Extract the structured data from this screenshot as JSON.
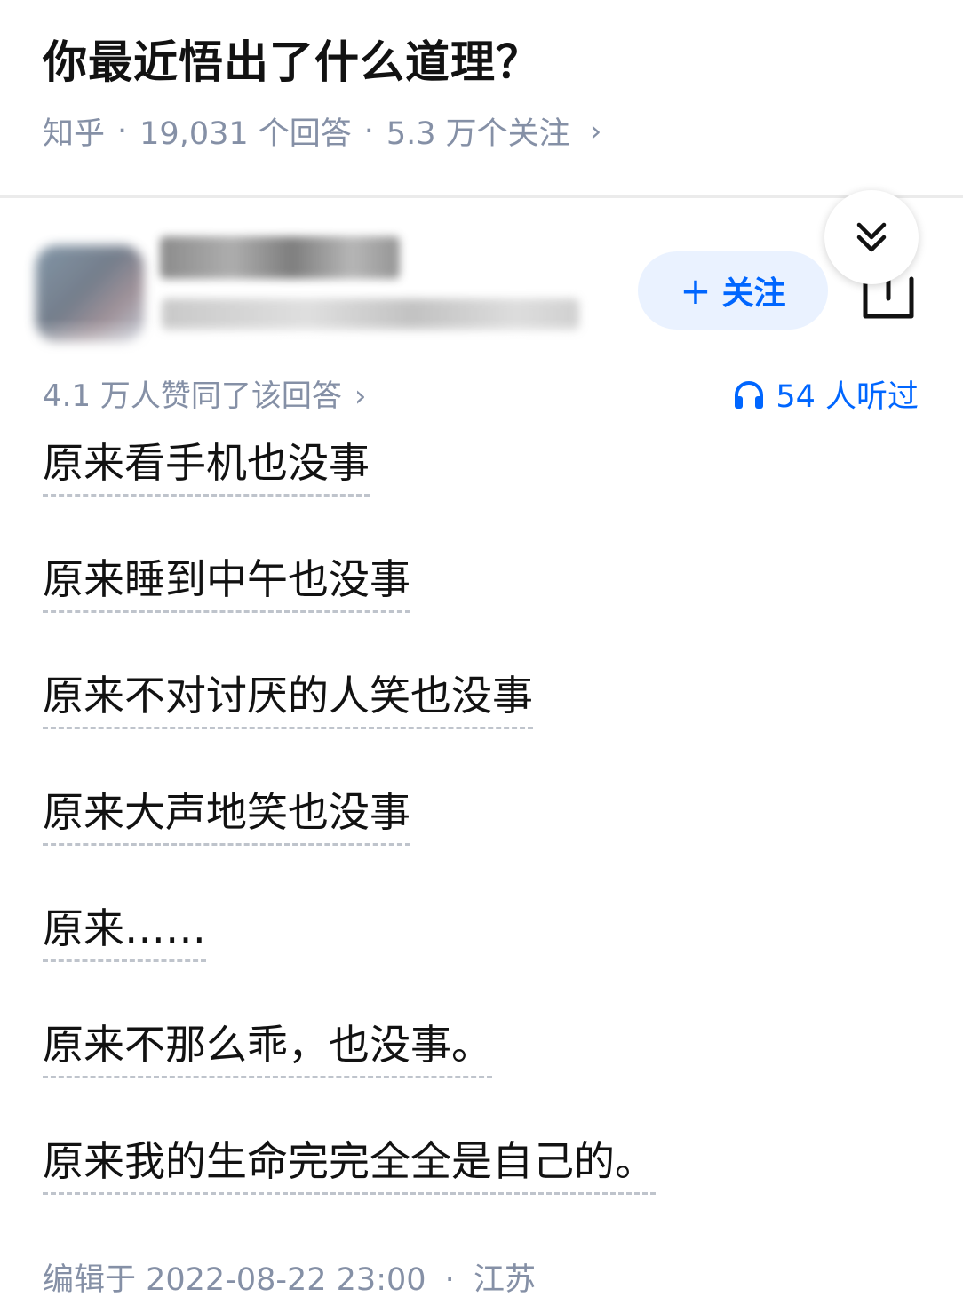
{
  "question": {
    "title": "你最近悟出了什么道理？",
    "source": "知乎",
    "answers": "19,031 个回答",
    "followers": "5.3 万个关注",
    "separator": "·",
    "chevron": "›"
  },
  "author": {
    "follow_label": "关注",
    "follow_plus": "+"
  },
  "answer": {
    "votes_text": "4.1 万人赞同了该回答",
    "votes_chevron": "›",
    "listened_text": "54 人听过",
    "lines": [
      "原来看手机也没事",
      "原来睡到中午也没事",
      "原来不对讨厌的人笑也没事",
      "原来大声地笑也没事",
      "原来……",
      "原来不那么乖，也没事。",
      "原来我的生命完完全全是自己的。"
    ],
    "edited_label": "编辑于 2022-08-22 23:00",
    "footer_separator": "·",
    "location": "江苏"
  },
  "icons": {
    "collapse": "double-chevron-down-icon",
    "share": "share-icon",
    "headphones": "headphones-icon"
  },
  "colors": {
    "accent": "#0066ff",
    "meta_gray": "#8590a6",
    "text": "#121212",
    "follow_bg": "#eaf2ff"
  }
}
